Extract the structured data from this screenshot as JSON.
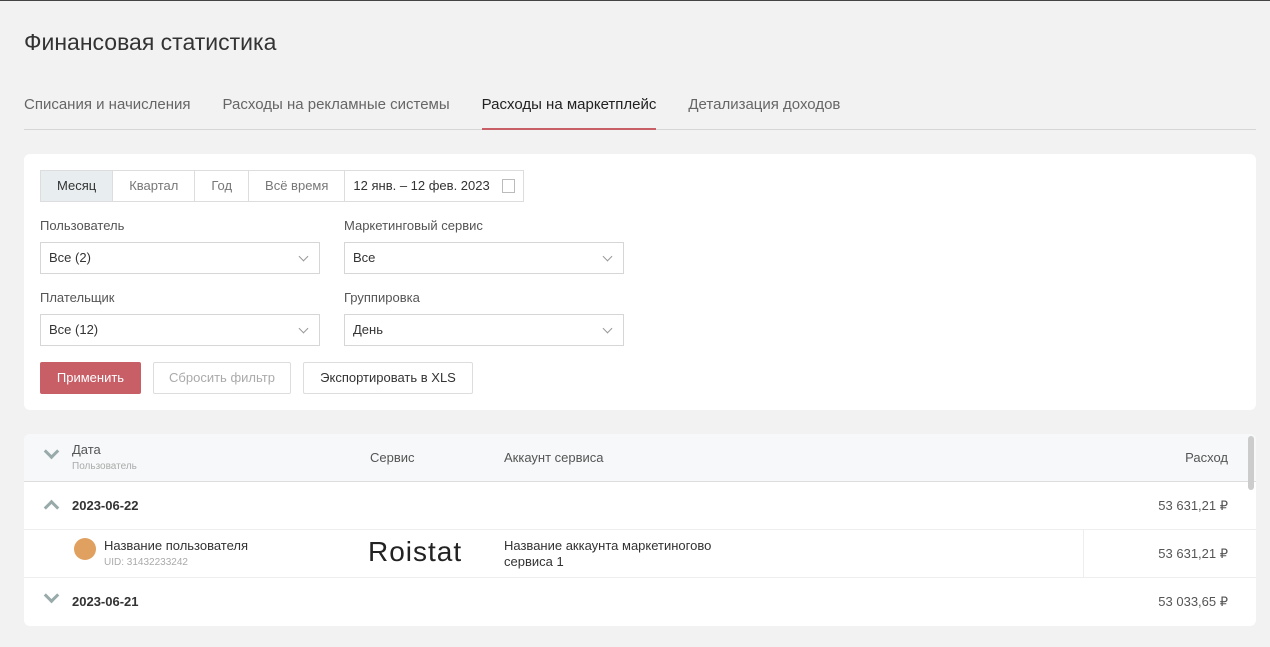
{
  "page_title": "Финансовая статистика",
  "tabs": [
    {
      "label": "Списания и начисления"
    },
    {
      "label": "Расходы на рекламные системы"
    },
    {
      "label": "Расходы на маркетплейс"
    },
    {
      "label": "Детализация доходов"
    }
  ],
  "filters": {
    "periods": [
      "Месяц",
      "Квартал",
      "Год",
      "Всё время"
    ],
    "date_range": "12 янв. – 12 фев. 2023",
    "user": {
      "label": "Пользователь",
      "value": "Все (2)"
    },
    "service": {
      "label": "Маркетинговый сервис",
      "value": "Все"
    },
    "payer": {
      "label": "Плательщик",
      "value": "Все (12)"
    },
    "grouping": {
      "label": "Группировка",
      "value": "День"
    },
    "apply": "Применить",
    "reset": "Сбросить фильтр",
    "export": "Экспортировать в XLS"
  },
  "table": {
    "headers": {
      "date": "Дата",
      "user": "Пользователь",
      "service": "Сервис",
      "account": "Аккаунт сервиса",
      "expense": "Расход"
    },
    "groups": [
      {
        "date": "2023-06-22",
        "total": "53 631,21 ₽",
        "expanded": true,
        "rows": [
          {
            "user": "Название пользователя",
            "uid": "UID: 31432233242",
            "service_logo": "Roistat",
            "account": "Название аккаунта маркетиногово сервиса 1",
            "expense": "53 631,21 ₽"
          }
        ]
      },
      {
        "date": "2023-06-21",
        "total": "53 033,65 ₽",
        "expanded": false
      }
    ]
  },
  "colors": {
    "accent": "#c85e66"
  }
}
